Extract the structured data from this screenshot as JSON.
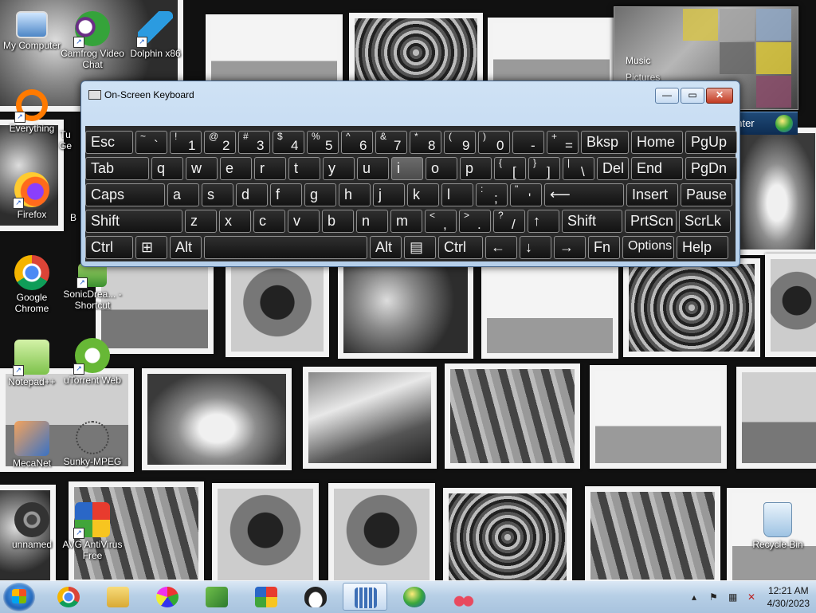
{
  "desktop_icons": [
    {
      "id": "my-computer",
      "label": "My Computer",
      "shortcut": false
    },
    {
      "id": "camfrog",
      "label": "Camfrog Video Chat",
      "shortcut": true
    },
    {
      "id": "dolphin",
      "label": "Dolphin x86",
      "shortcut": true
    },
    {
      "id": "everything",
      "label": "Everything",
      "shortcut": true
    },
    {
      "id": "firefox",
      "label": "Firefox",
      "shortcut": true
    },
    {
      "id": "chrome",
      "label": "Google Chrome",
      "shortcut": false
    },
    {
      "id": "sonic",
      "label": "SonicDrea... - Shortcut",
      "shortcut": true
    },
    {
      "id": "notepadpp",
      "label": "Notepad++",
      "shortcut": true
    },
    {
      "id": "utorrent",
      "label": "uTorrent Web",
      "shortcut": true
    },
    {
      "id": "mecanet",
      "label": "MecaNet",
      "shortcut": false
    },
    {
      "id": "sunky",
      "label": "Sunky-MPEG",
      "shortcut": false
    },
    {
      "id": "unnamed",
      "label": "unnamed",
      "shortcut": false
    },
    {
      "id": "avg",
      "label": "AVG AntiVirus Free",
      "shortcut": true
    },
    {
      "id": "recycle",
      "label": "Recycle Bin",
      "shortcut": false
    }
  ],
  "partial_labels": {
    "tu": "Tu",
    "ge": "Ge",
    "b": "B"
  },
  "gadget": {
    "items": [
      "Music",
      "Pictures"
    ],
    "bar_text": "enter"
  },
  "osk": {
    "title": "On-Screen Keyboard",
    "controls": {
      "minimize": "—",
      "restore": "▭",
      "close": "✕"
    },
    "rows": [
      [
        {
          "l": "Esc"
        },
        {
          "u": "~",
          "d": "`"
        },
        {
          "u": "!",
          "d": "1"
        },
        {
          "u": "@",
          "d": "2"
        },
        {
          "u": "#",
          "d": "3"
        },
        {
          "u": "$",
          "d": "4"
        },
        {
          "u": "%",
          "d": "5"
        },
        {
          "u": "^",
          "d": "6"
        },
        {
          "u": "&",
          "d": "7"
        },
        {
          "u": "*",
          "d": "8"
        },
        {
          "u": "(",
          "d": "9"
        },
        {
          "u": ")",
          "d": "0"
        },
        {
          "u": "",
          "d": "-"
        },
        {
          "u": "+",
          "d": "="
        },
        {
          "l": "Bksp"
        },
        {
          "l": "Home"
        },
        {
          "l": "PgUp"
        }
      ],
      [
        {
          "l": "Tab"
        },
        {
          "l": "q"
        },
        {
          "l": "w"
        },
        {
          "l": "e"
        },
        {
          "l": "r"
        },
        {
          "l": "t"
        },
        {
          "l": "y"
        },
        {
          "l": "u"
        },
        {
          "l": "i"
        },
        {
          "l": "o"
        },
        {
          "l": "p"
        },
        {
          "u": "{",
          "d": "["
        },
        {
          "u": "}",
          "d": "]"
        },
        {
          "u": "|",
          "d": "\\"
        },
        {
          "l": "Del"
        },
        {
          "l": "End"
        },
        {
          "l": "PgDn"
        }
      ],
      [
        {
          "l": "Caps"
        },
        {
          "l": "a"
        },
        {
          "l": "s"
        },
        {
          "l": "d"
        },
        {
          "l": "f"
        },
        {
          "l": "g"
        },
        {
          "l": "h"
        },
        {
          "l": "j"
        },
        {
          "l": "k"
        },
        {
          "l": "l"
        },
        {
          "u": ":",
          "d": ";"
        },
        {
          "u": "\"",
          "d": "'"
        },
        {
          "l": "⟵"
        },
        {
          "l": "Insert"
        },
        {
          "l": "Pause"
        }
      ],
      [
        {
          "l": "Shift"
        },
        {
          "l": "z"
        },
        {
          "l": "x"
        },
        {
          "l": "c"
        },
        {
          "l": "v"
        },
        {
          "l": "b"
        },
        {
          "l": "n"
        },
        {
          "l": "m"
        },
        {
          "u": "<",
          "d": ","
        },
        {
          "u": ">",
          "d": "."
        },
        {
          "u": "?",
          "d": "/"
        },
        {
          "l": "↑"
        },
        {
          "l": "Shift"
        },
        {
          "l": "PrtScn"
        },
        {
          "l": "ScrLk"
        }
      ],
      [
        {
          "l": "Ctrl"
        },
        {
          "l": "⊞"
        },
        {
          "l": "Alt"
        },
        {
          "l": ""
        },
        {
          "l": "Alt"
        },
        {
          "l": "▤"
        },
        {
          "l": "Ctrl"
        },
        {
          "l": "←"
        },
        {
          "l": "↓"
        },
        {
          "l": "→"
        },
        {
          "l": "Fn"
        },
        {
          "l": "Options"
        },
        {
          "l": "Help"
        }
      ]
    ],
    "hover_key": "i"
  },
  "taskbar": {
    "apps": [
      "chrome",
      "explorer",
      "paint",
      "tools",
      "winrar",
      "linux",
      "osk",
      "windows-media",
      "snipping"
    ],
    "active": "osk",
    "clock": {
      "time": "12:21 AM",
      "date": "4/30/2023"
    }
  },
  "colors": {
    "key_bg": "#1a1a1a",
    "key_border": "#8f8f8f",
    "taskbar": "#b7cfe6"
  }
}
